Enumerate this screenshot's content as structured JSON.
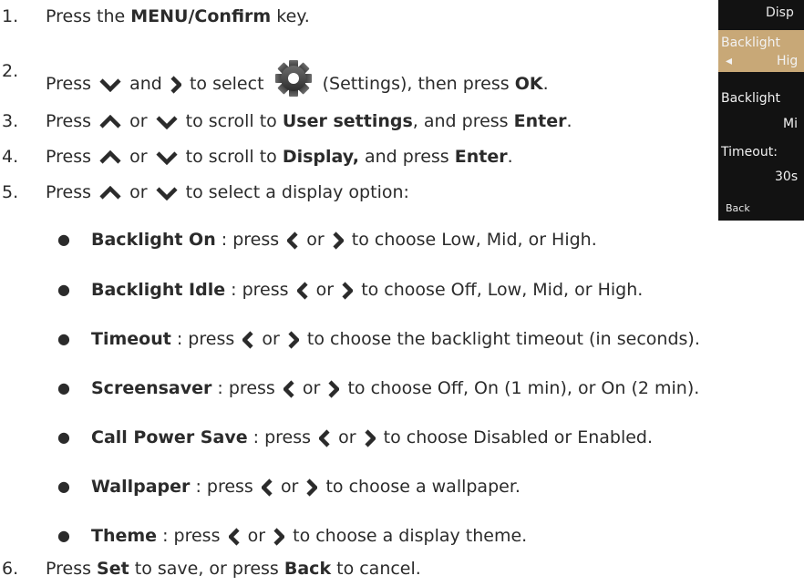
{
  "steps": [
    {
      "num": "1.",
      "a": "Press the ",
      "b": "MENU/Confirm",
      "c": " key."
    },
    {
      "num": "2.",
      "a": "Press",
      "b": "and",
      "c": "to select",
      "d": "(Settings), then press ",
      "e": "OK",
      "f": "."
    },
    {
      "num": "3.",
      "a": "Press",
      "b": "or",
      "c": "to scroll to ",
      "d": "User settings",
      "e": ", and press ",
      "f": "Enter",
      "g": "."
    },
    {
      "num": "4.",
      "a": "Press",
      "b": "or",
      "c": "to scroll to ",
      "d": "Display,",
      "e": " and press ",
      "f": "Enter",
      "g": "."
    },
    {
      "num": "5.",
      "a": "Press",
      "b": "or",
      "c": "to select a display option:"
    },
    {
      "num": "6.",
      "a": "Press ",
      "b": "Set",
      "c": " to save, or press ",
      "d": "Back",
      "e": " to cancel."
    }
  ],
  "options": [
    {
      "name": "Backlight On",
      "pre": " : press",
      "or": "or",
      "post": "to  choose Low, Mid, or High."
    },
    {
      "name": "Backlight Idle",
      "pre": " : press",
      "or": "or",
      "post": "to  choose Off, Low, Mid, or High."
    },
    {
      "name": "Timeout",
      "pre": " : press",
      "or": "or",
      "post": "to  choose the backlight timeout (in seconds)."
    },
    {
      "name": "Screensaver",
      "pre": " : press",
      "or": "or",
      "post": "to  choose Off, On (1 min), or On (2 min)."
    },
    {
      "name": "Call Power Save",
      "pre": " : press",
      "or": "or",
      "post": "to  choose Disabled or Enabled."
    },
    {
      "name": "Wallpaper",
      "pre": " : press",
      "or": "or",
      "post": "to choose a wallpaper."
    },
    {
      "name": "Theme",
      "pre": " : press",
      "or": "or",
      "post": "to  choose a display theme."
    }
  ],
  "phone": {
    "title": "Disp",
    "rows": [
      "Backlight",
      "Hig",
      "Backlight",
      "Mi",
      "Timeout:",
      "30s"
    ],
    "left_arrow": "◂",
    "softkey": "Back",
    "accent": "#c8a877"
  },
  "icons": {
    "up": "chevron-up-icon",
    "down": "chevron-down-icon",
    "left": "chevron-left-icon",
    "right": "chevron-right-icon",
    "settings": "gear-icon"
  }
}
